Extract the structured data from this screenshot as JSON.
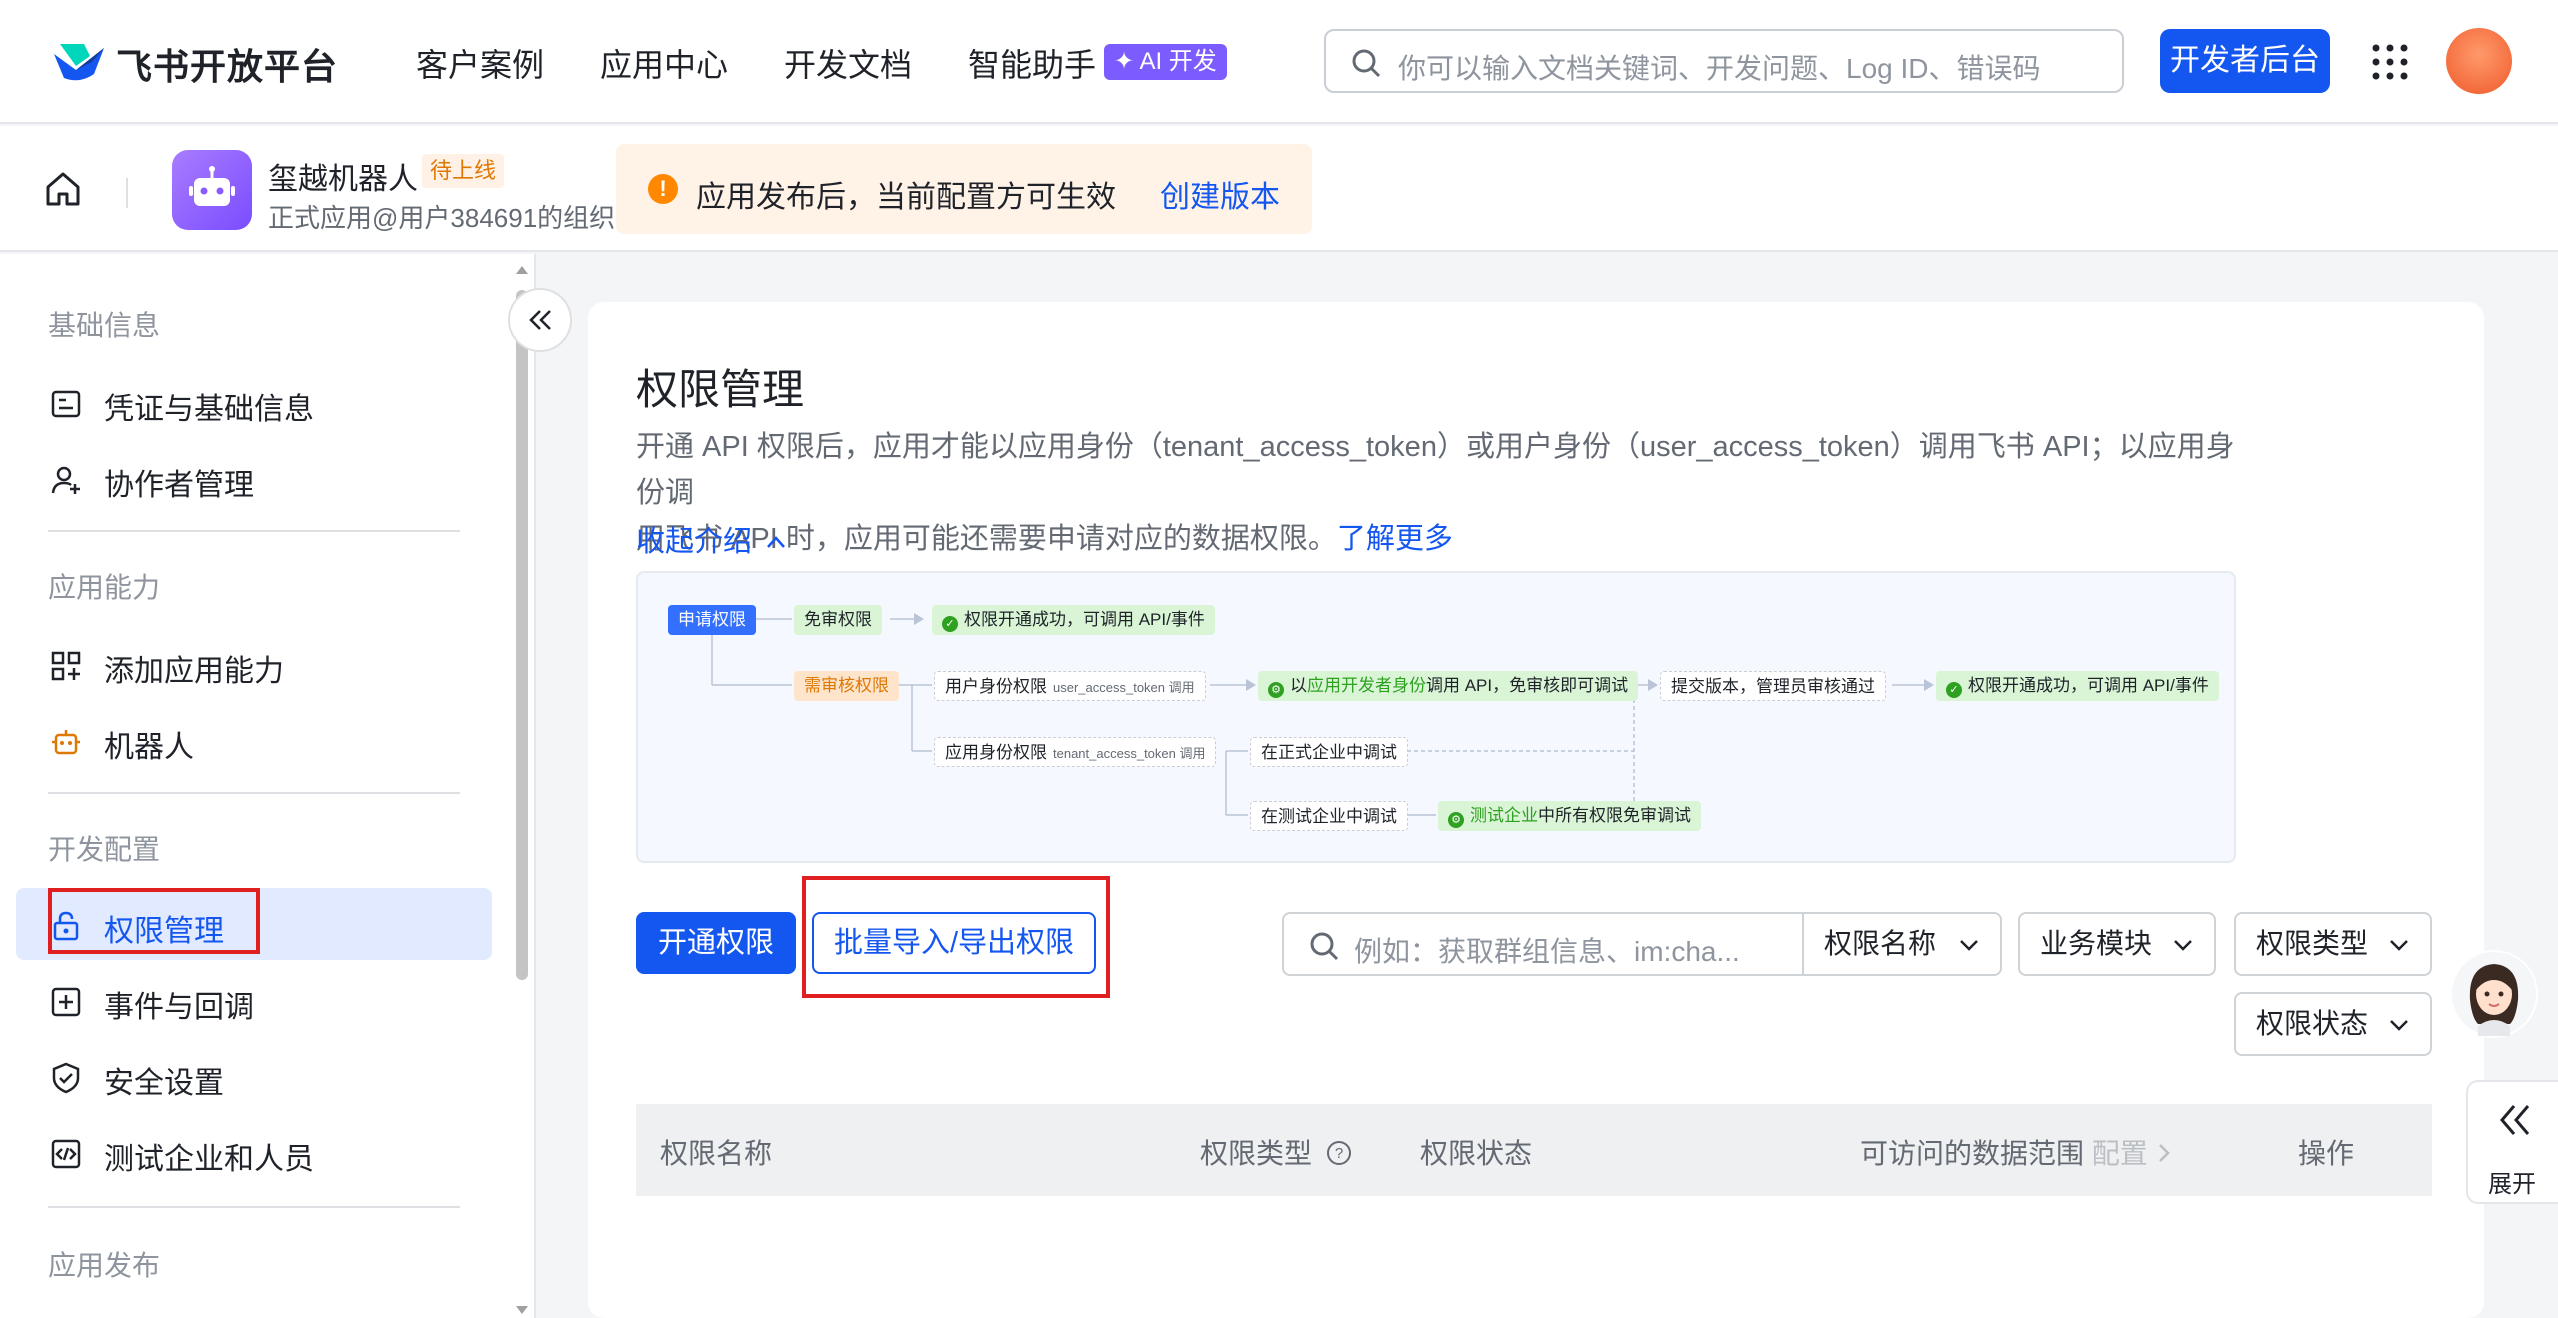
{
  "header": {
    "brand": "飞书开放平台",
    "nav": [
      "客户案例",
      "应用中心",
      "开发文档",
      "智能助手"
    ],
    "ai_badge": "✦ AI 开发",
    "search_placeholder": "你可以输入文档关键词、开发问题、Log ID、错误码",
    "dev_console": "开发者后台"
  },
  "app": {
    "name": "玺越机器人",
    "status_tag": "待上线",
    "subtitle": "正式应用@用户384691的组织",
    "notice": "应用发布后，当前配置方可生效",
    "notice_link": "创建版本"
  },
  "sidebar": {
    "groups": [
      {
        "title": "基础信息",
        "items": [
          {
            "label": "凭证与基础信息",
            "icon": "credential-icon"
          },
          {
            "label": "协作者管理",
            "icon": "user-add-icon"
          }
        ]
      },
      {
        "title": "应用能力",
        "items": [
          {
            "label": "添加应用能力",
            "icon": "apps-add-icon"
          },
          {
            "label": "机器人",
            "icon": "robot-icon"
          }
        ]
      },
      {
        "title": "开发配置",
        "items": [
          {
            "label": "权限管理",
            "icon": "lock-icon"
          },
          {
            "label": "事件与回调",
            "icon": "event-icon"
          },
          {
            "label": "安全设置",
            "icon": "shield-icon"
          },
          {
            "label": "测试企业和人员",
            "icon": "code-icon"
          }
        ]
      },
      {
        "title": "应用发布",
        "items": []
      }
    ],
    "active": "权限管理"
  },
  "main": {
    "title": "权限管理",
    "desc_line1": "开通 API 权限后，应用才能以应用身份（tenant_access_token）或用户身份（user_access_token）调用飞书 API；以应用身份调",
    "desc_line2": "用飞书 API 时，应用可能还需要申请对应的数据权限。",
    "learn_more": "了解更多",
    "collapse_intro": "收起介绍",
    "diagram": {
      "apply": "申请权限",
      "free": "免审权限",
      "free_result": "权限开通成功，可调用 API/事件",
      "review": "需审核权限",
      "user_identity": "用户身份权限",
      "user_token": "user_access_token 调用",
      "dev_call_a": "以",
      "dev_call_b": "应用开发者身份",
      "dev_call_c": "调用 API，免审核即可调试",
      "submit": "提交版本，管理员审核通过",
      "final_result": "权限开通成功，可调用 API/事件",
      "app_identity": "应用身份权限",
      "tenant_token": "tenant_access_token 调用",
      "prod_debug": "在正式企业中调试",
      "test_debug": "在测试企业中调试",
      "test_free_a": "测试企业",
      "test_free_b": "中所有权限免审调试"
    },
    "btn_open": "开通权限",
    "btn_batch": "批量导入/导出权限",
    "filter_placeholder": "例如：获取群组信息、im:cha...",
    "filter_field": "权限名称",
    "filter_module": "业务模块",
    "filter_type": "权限类型",
    "filter_status": "权限状态",
    "table_headers": {
      "name": "权限名称",
      "type": "权限类型",
      "status": "权限状态",
      "scope": "可访问的数据范围",
      "scope_config": "配置",
      "action": "操作"
    }
  },
  "side_tools": {
    "expand": "展开"
  },
  "colors": {
    "primary": "#1456f0",
    "highlight_box": "#e02020",
    "active_bg": "#e1eaff"
  }
}
